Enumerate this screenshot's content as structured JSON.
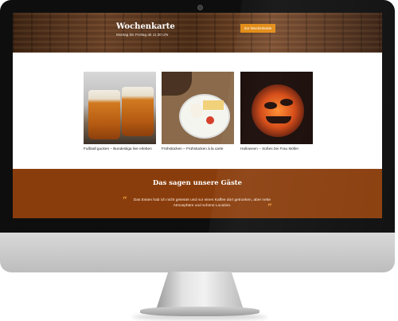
{
  "hero": {
    "title": "Wochenkarte",
    "subtitle": "Montag bis Freitag ab 11:30 Uhr",
    "button_label": "Zur Wochenkarte"
  },
  "cards": [
    {
      "caption": "Fußball gucken – Bundesliga live erleben",
      "image": "beer-glasses-photo"
    },
    {
      "caption": "Frühstücken – Frühstücken à la carte",
      "image": "breakfast-plate-photo"
    },
    {
      "caption": "Halloween – Süßes bei Frau Möller",
      "image": "halloween-pumpkin-photo"
    }
  ],
  "testimonials": {
    "title": "Das sagen unsere Gäste",
    "quote": "Das Essen hab ich nicht getestet und nur einen Kaffee dort getrunken, aber nette Atmosphäre und schöne Location.",
    "open_mark": "“",
    "close_mark": "”",
    "slide_count": 3,
    "active_slide": 2
  },
  "colors": {
    "accent": "#e28a12",
    "testimonial_bg": "#8a3d0c",
    "quote_mark": "#f0a53a"
  }
}
